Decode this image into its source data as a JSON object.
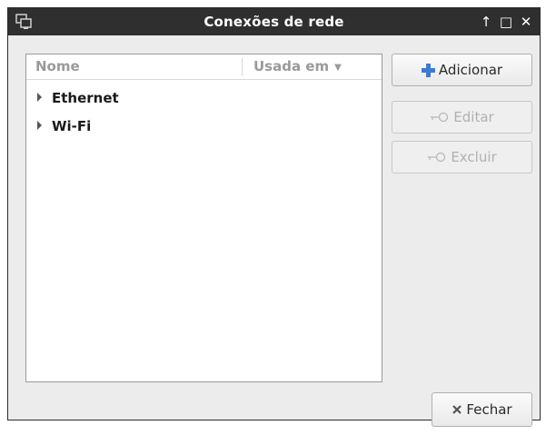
{
  "window": {
    "title": "Conexões de rede"
  },
  "list": {
    "columns": [
      "Nome",
      "Usada em"
    ],
    "rows": [
      {
        "label": "Ethernet"
      },
      {
        "label": "Wi-Fi"
      }
    ]
  },
  "buttons": {
    "add": "Adicionar",
    "edit": "Editar",
    "delete": "Excluir",
    "close": "Fechar"
  },
  "colors": {
    "titlebar": "#2f2f2f",
    "add_icon": "#3a7bd5"
  }
}
